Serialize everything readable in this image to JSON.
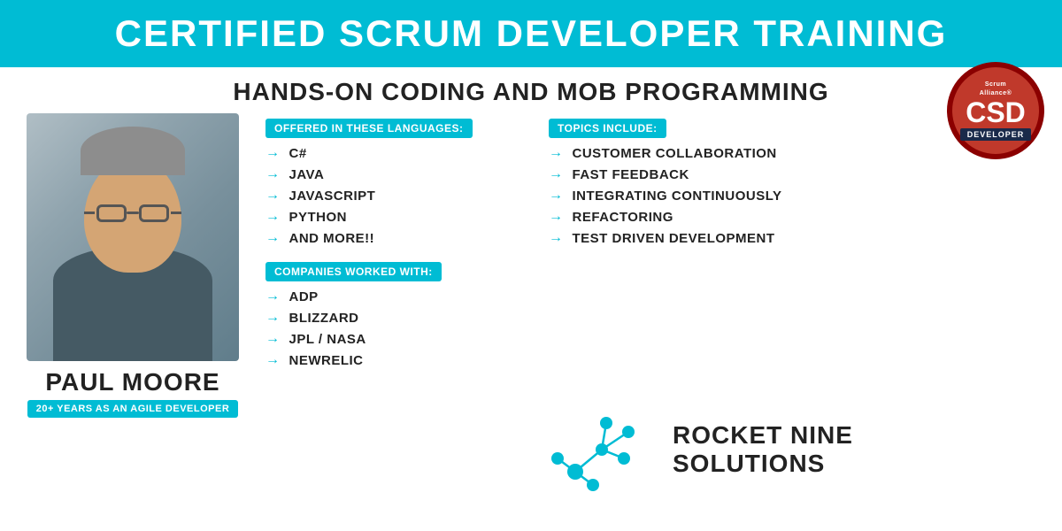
{
  "header": {
    "title": "CERTIFIED SCRUM DEVELOPER TRAINING"
  },
  "subheader": {
    "title": "HANDS-ON CODING AND MOB PROGRAMMING"
  },
  "person": {
    "name": "PAUL MOORE",
    "title": "20+ YEARS AS AN AGILE DEVELOPER"
  },
  "languages_section": {
    "label": "OFFERED IN THESE LANGUAGES:",
    "items": [
      "C#",
      "JAVA",
      "JAVASCRIPT",
      "PYTHON",
      "AND MORE!!"
    ]
  },
  "companies_section": {
    "label": "COMPANIES WORKED WITH:",
    "items": [
      "ADP",
      "BLIZZARD",
      "JPL / NASA",
      "NEWRELIC"
    ]
  },
  "topics_section": {
    "label": "TOPICS INCLUDE:",
    "items": [
      "CUSTOMER COLLABORATION",
      "FAST FEEDBACK",
      "INTEGRATING CONTINUOUSLY",
      "REFACTORING",
      "TEST DRIVEN DEVELOPMENT"
    ]
  },
  "badge": {
    "brand": "Scrum Alliance®",
    "code": "CSD",
    "type": "DEVELOPER"
  },
  "logo": {
    "line1": "ROCKET NINE",
    "line2": "SOLUTIONS"
  },
  "colors": {
    "cyan": "#00bcd4",
    "red": "#c0392b",
    "navy": "#1a2a4a",
    "dark": "#222222",
    "white": "#ffffff"
  }
}
